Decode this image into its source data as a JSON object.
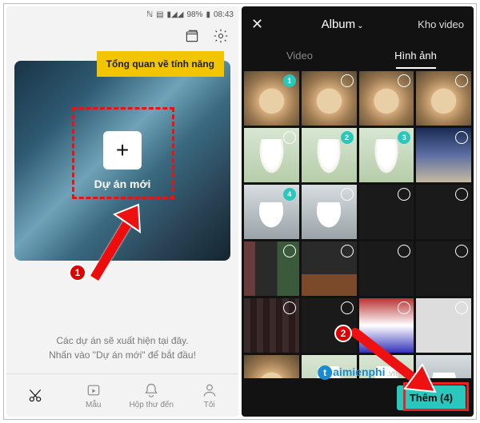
{
  "left": {
    "status": {
      "battery": "98%",
      "time": "08:43"
    },
    "tooltip_text": "Tổng quan về tính năng",
    "new_project_label": "Dự án mới",
    "hint_line1": "Các dự án sẽ xuất hiện tại đây.",
    "hint_line2": "Nhấn vào \"Dự án mới\" để bắt đầu!",
    "tabs": {
      "mau": "Mẫu",
      "inbox": "Hộp thư đến",
      "me": "Tôi"
    }
  },
  "right": {
    "header": {
      "album": "Album",
      "kho": "Kho video"
    },
    "subtabs": {
      "video": "Video",
      "image": "Hình ảnh"
    },
    "picked": {
      "n1": "1",
      "n2": "2",
      "n3": "3",
      "n4": "4"
    },
    "add_label": "Thêm (4)"
  },
  "annotations": {
    "step1": "1",
    "step2": "2"
  },
  "watermark": {
    "part_a": "aimienphi",
    "part_b": ".vn"
  }
}
